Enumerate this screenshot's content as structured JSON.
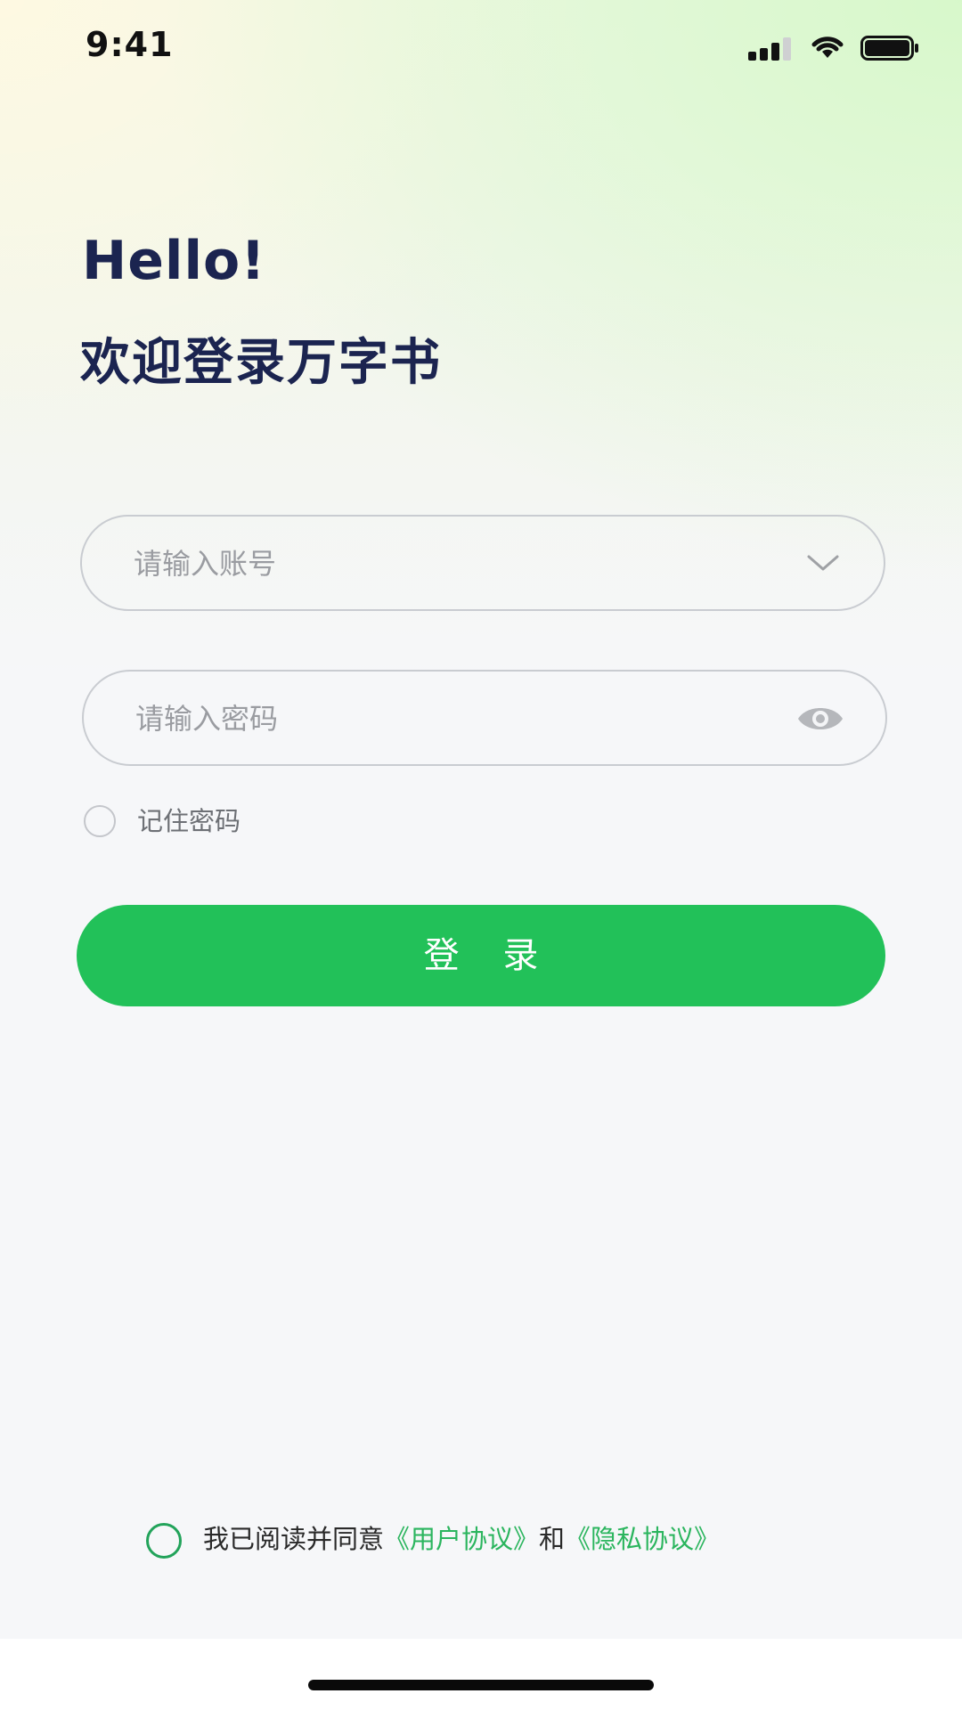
{
  "status_bar": {
    "time": "9:41"
  },
  "header": {
    "greeting": "Hello!",
    "subtitle": "欢迎登录万字书"
  },
  "form": {
    "account_placeholder": "请输入账号",
    "password_placeholder": "请输入密码",
    "remember_label": "记住密码",
    "login_label": "登 录"
  },
  "agreement": {
    "prefix": "我已阅读并同意",
    "user_agreement": "《用户协议》",
    "conjunction": "和",
    "privacy_agreement": "《隐私协议》"
  },
  "colors": {
    "accent": "#22c159",
    "title": "#1b2450",
    "link": "#2bb55e"
  },
  "icons": [
    "signal-icon",
    "wifi-icon",
    "battery-icon",
    "chevron-down-icon",
    "eye-icon",
    "radio-icon"
  ]
}
